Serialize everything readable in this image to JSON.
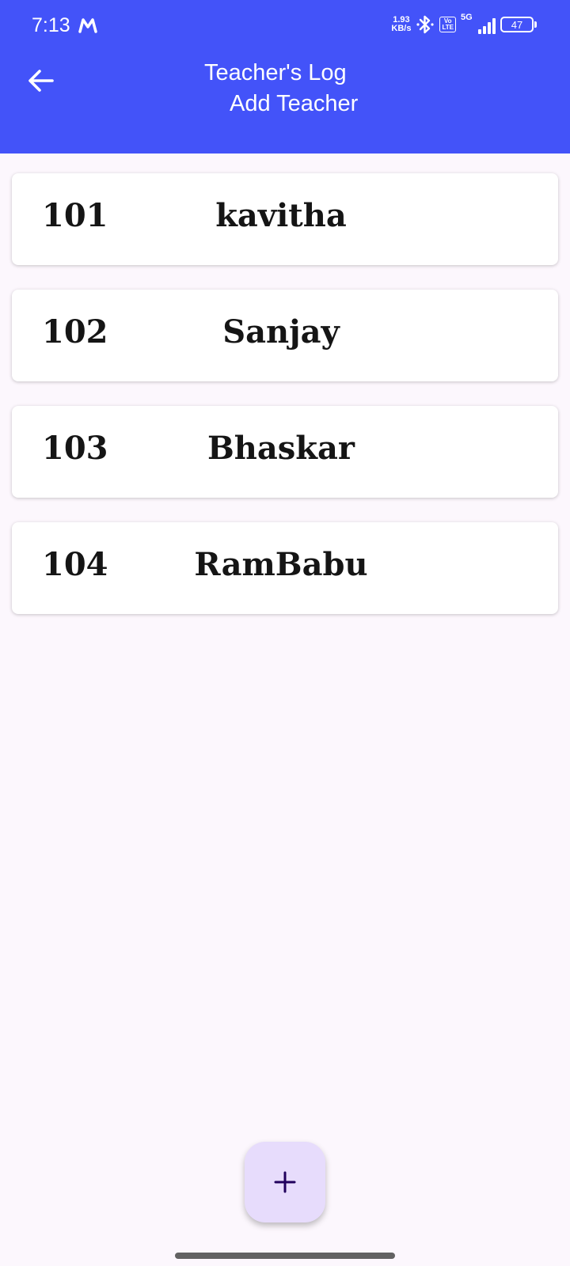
{
  "status_bar": {
    "time": "7:13",
    "carrier_icon": "m-icon",
    "net_speed_value": "1.93",
    "net_speed_unit": "KB/s",
    "volte_top": "Vo",
    "volte_bottom": "LTE",
    "network_type": "5G",
    "battery_level": "47"
  },
  "app_bar": {
    "title": "Teacher's Log",
    "action_label": "Add Teacher",
    "back_icon": "arrow-left-icon"
  },
  "teachers": [
    {
      "id": "101",
      "name": "kavitha"
    },
    {
      "id": "102",
      "name": "Sanjay"
    },
    {
      "id": "103",
      "name": "Bhaskar"
    },
    {
      "id": "104",
      "name": "RamBabu"
    }
  ],
  "fab": {
    "icon": "plus-icon"
  },
  "colors": {
    "primary": "#4353f9",
    "background": "#fcf7fd",
    "card": "#ffffff",
    "fab": "#e7dcfc",
    "fab_icon": "#21005d"
  }
}
